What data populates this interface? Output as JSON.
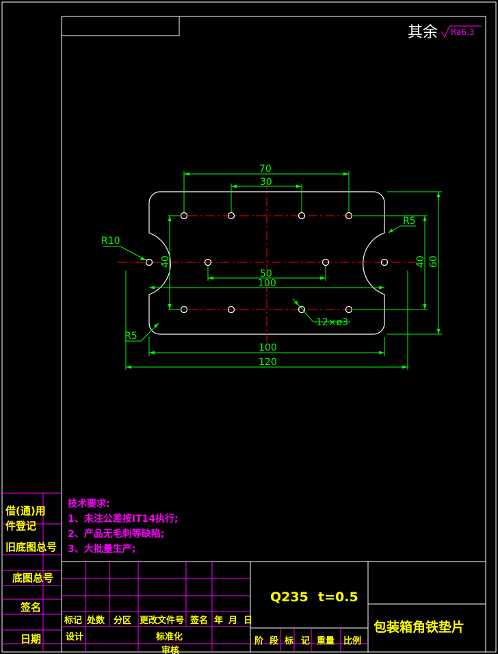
{
  "roughness": {
    "prefix": "其余",
    "value": "Ra6.3"
  },
  "dimensions": {
    "d70": "70",
    "d30": "30",
    "d50": "50",
    "d100a": "100",
    "d100b": "100",
    "d120": "120",
    "h40l": "40",
    "h40r": "40",
    "h60": "60",
    "r10": "R10",
    "r5a": "R5",
    "r5b": "R5",
    "holes": "12×ø3"
  },
  "notes": {
    "heading": "技术要求:",
    "items": [
      "1、未注公差按IT14执行;",
      "2、产品无毛刺等缺陷;",
      "3、大批量生产;"
    ]
  },
  "side_labels": [
    "借(通)用",
    "件登记",
    "旧底图总号",
    "底图总号",
    "签名",
    "日期"
  ],
  "title_block": {
    "material": "Q235",
    "thickness": "t=0.5",
    "part_name": "包装箱角铁垫片",
    "headers": [
      "标记",
      "处数",
      "分区",
      "更改文件号",
      "签名",
      "年",
      "月",
      "日"
    ],
    "design": "设计",
    "standardize": "标准化",
    "review": "审核",
    "stage_labels": [
      "阶",
      "段",
      "标",
      "记",
      "重量",
      "比例"
    ]
  },
  "colors": {
    "frame": "#ffffff",
    "grid": "#ff00ff",
    "dim": "#00ff00",
    "center": "#ff0000",
    "text": "#ffff00",
    "part": "#ffffff"
  }
}
